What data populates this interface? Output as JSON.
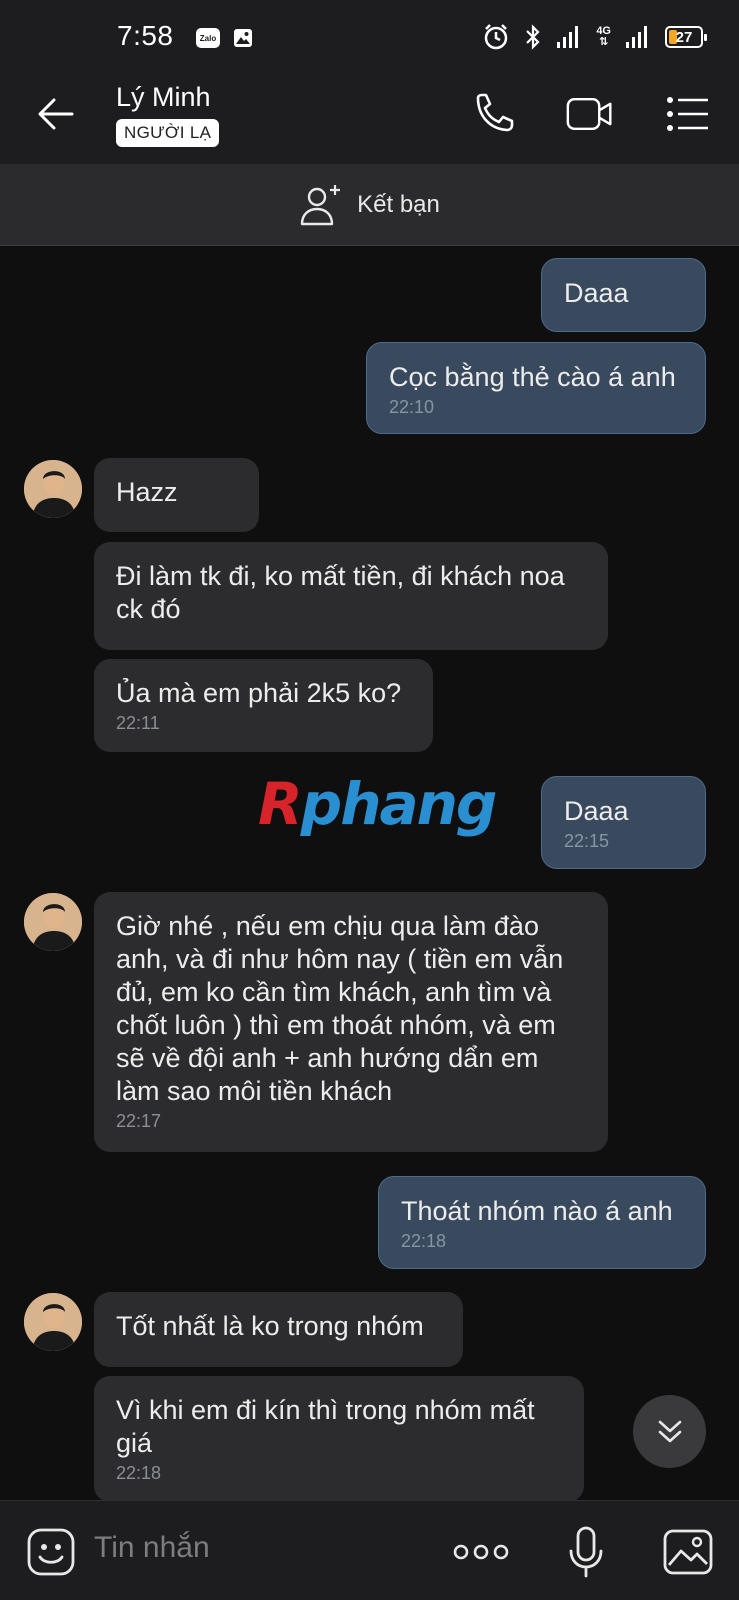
{
  "status_bar": {
    "time": "7:58",
    "zalo_badge": "Zalo",
    "network": "4G",
    "battery": "27"
  },
  "header": {
    "name": "Lý Minh",
    "badge": "NGƯỜI LẠ"
  },
  "add_friend": {
    "label": "Kết bạn"
  },
  "messages": [
    {
      "dir": "out",
      "text": "Daaa",
      "time": ""
    },
    {
      "dir": "out",
      "text": "Cọc bằng thẻ cào á anh",
      "time": "22:10"
    },
    {
      "dir": "in",
      "text": "Hazz",
      "time": ""
    },
    {
      "dir": "in",
      "text": "Đi làm tk đi, ko mất tiền, đi khách noa ck đó",
      "time": ""
    },
    {
      "dir": "in",
      "text": "Ủa mà em phải 2k5 ko?",
      "time": "22:11"
    },
    {
      "dir": "out",
      "text": "Daaa",
      "time": "22:15"
    },
    {
      "dir": "in",
      "text": "Giờ nhé , nếu em chịu qua làm đào anh, và đi như hôm nay ( tiền em vẫn đủ, em ko cần tìm khách, anh tìm và chốt luôn ) thì em thoát nhóm, và em sẽ về đội anh + anh hướng dẩn em làm sao môi tiền khách",
      "time": "22:17"
    },
    {
      "dir": "out",
      "text": "Thoát nhóm nào á anh",
      "time": "22:18"
    },
    {
      "dir": "in",
      "text": "Tốt nhất là ko trong nhóm",
      "time": ""
    },
    {
      "dir": "in",
      "text": "Vì khi em đi kín thì trong nhóm mất giá",
      "time": "22:18"
    }
  ],
  "watermark": {
    "first": "R",
    "rest": "phang"
  },
  "composer": {
    "placeholder": "Tin nhắn"
  },
  "colors": {
    "background": "#0f0f10",
    "incoming_bubble": "#2c2c2e",
    "outgoing_bubble": "#3a4a5e",
    "outgoing_border": "#4b6a8d",
    "timestamp": "#8a8f96"
  },
  "icons": [
    "back-arrow-icon",
    "phone-icon",
    "video-icon",
    "menu-icon",
    "add-person-icon",
    "emoji-icon",
    "more-dots-icon",
    "mic-icon",
    "image-icon",
    "chevron-double-down-icon"
  ]
}
